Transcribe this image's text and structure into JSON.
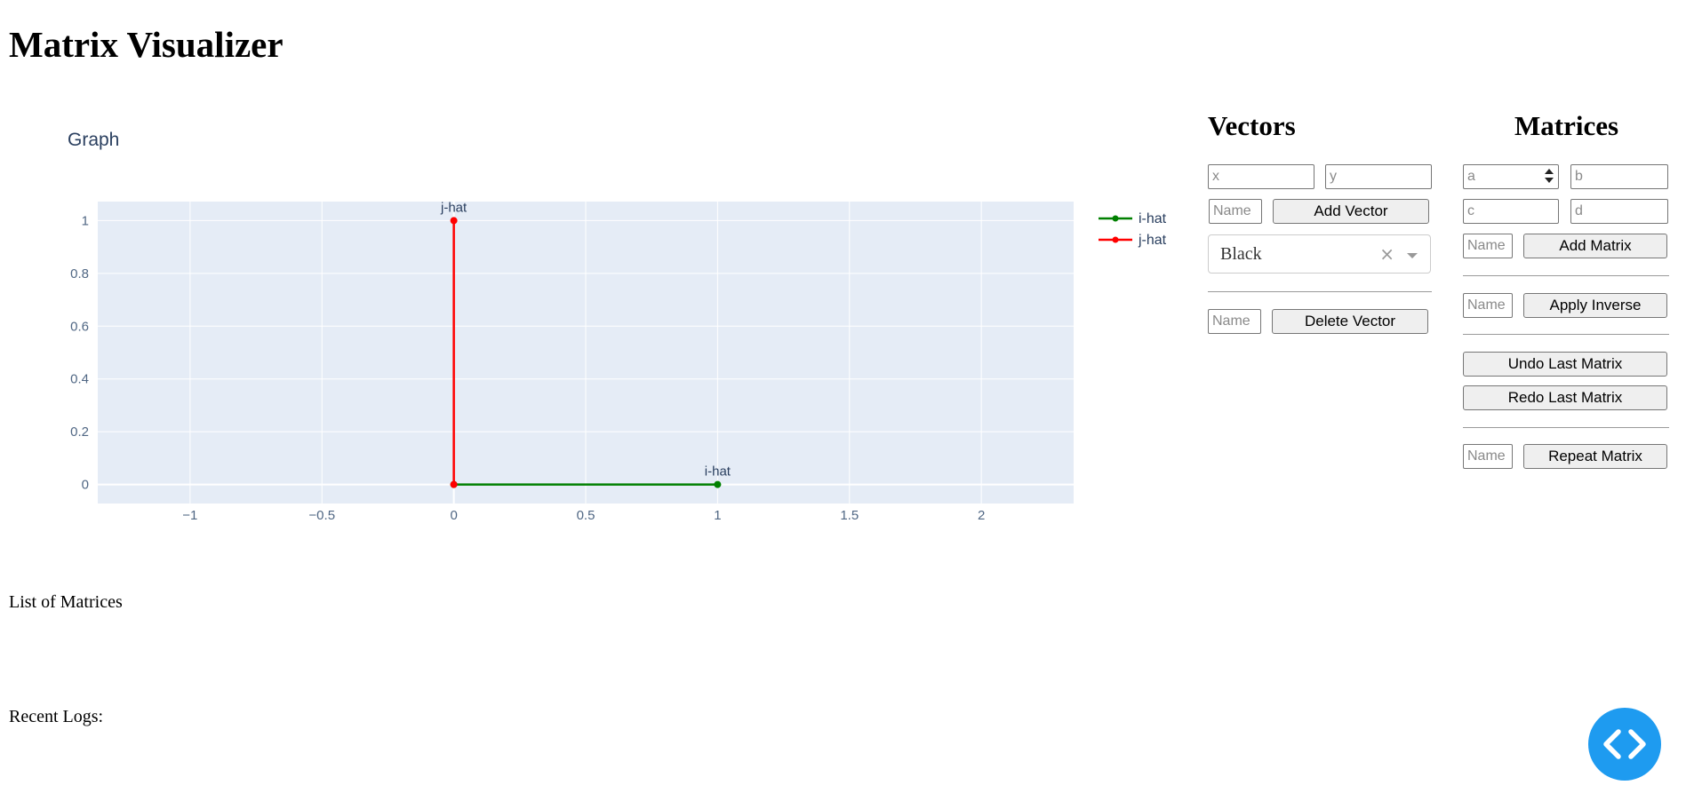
{
  "app": {
    "title": "Matrix Visualizer"
  },
  "graph": {
    "title": "Graph",
    "legend": [
      {
        "name": "i-hat",
        "color": "#008000"
      },
      {
        "name": "j-hat",
        "color": "#ff0000"
      }
    ]
  },
  "chart_data": {
    "type": "line",
    "title": "Graph",
    "xlim": [
      -1.35,
      2.35
    ],
    "ylim": [
      -0.072,
      1.072
    ],
    "x_ticks": [
      -1,
      -0.5,
      0,
      0.5,
      1,
      1.5,
      2
    ],
    "x_tick_labels": [
      "−1",
      "−0.5",
      "0",
      "0.5",
      "1",
      "1.5",
      "2"
    ],
    "y_ticks": [
      0,
      0.2,
      0.4,
      0.6,
      0.8,
      1
    ],
    "y_tick_labels": [
      "0",
      "0.2",
      "0.4",
      "0.6",
      "0.8",
      "1"
    ],
    "grid": true,
    "legend_position": "right",
    "series": [
      {
        "name": "i-hat",
        "color": "#008000",
        "x": [
          0,
          1
        ],
        "y": [
          0,
          0
        ],
        "end_label": "i-hat"
      },
      {
        "name": "j-hat",
        "color": "#ff0000",
        "x": [
          0,
          0
        ],
        "y": [
          0,
          1
        ],
        "end_label": "j-hat"
      }
    ]
  },
  "vectors": {
    "title": "Vectors",
    "x_placeholder": "x",
    "y_placeholder": "y",
    "name_placeholder": "Name",
    "add_label": "Add Vector",
    "color_value": "Black",
    "clear_glyph": "×",
    "delete_name_placeholder": "Name",
    "delete_label": "Delete Vector"
  },
  "matrices": {
    "title": "Matrices",
    "a_placeholder": "a",
    "b_placeholder": "b",
    "c_placeholder": "c",
    "d_placeholder": "d",
    "name_placeholder": "Name",
    "add_label": "Add Matrix",
    "inverse_name_placeholder": "Name",
    "inverse_label": "Apply Inverse",
    "undo_label": "Undo Last Matrix",
    "redo_label": "Redo Last Matrix",
    "repeat_name_placeholder": "Name",
    "repeat_label": "Repeat Matrix"
  },
  "sections": {
    "list_of_matrices": "List of Matrices",
    "recent_logs": "Recent Logs:"
  }
}
